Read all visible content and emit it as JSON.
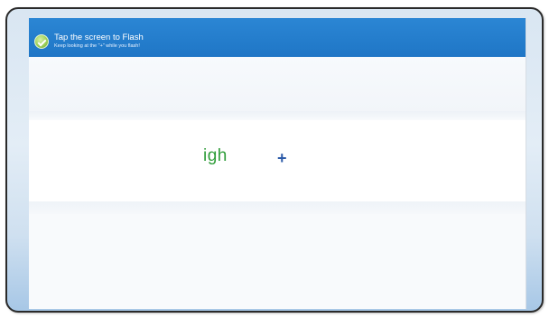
{
  "header": {
    "title": "Tap the screen to Flash",
    "subtitle": "Keep looking at the \"+\" while you flash!",
    "icon": "check-circle-icon",
    "background_color": "#1f76c6"
  },
  "flash": {
    "word": "igh",
    "word_color": "#2f9d3a",
    "fixation_symbol": "+",
    "fixation_color": "#2b5aa8"
  }
}
